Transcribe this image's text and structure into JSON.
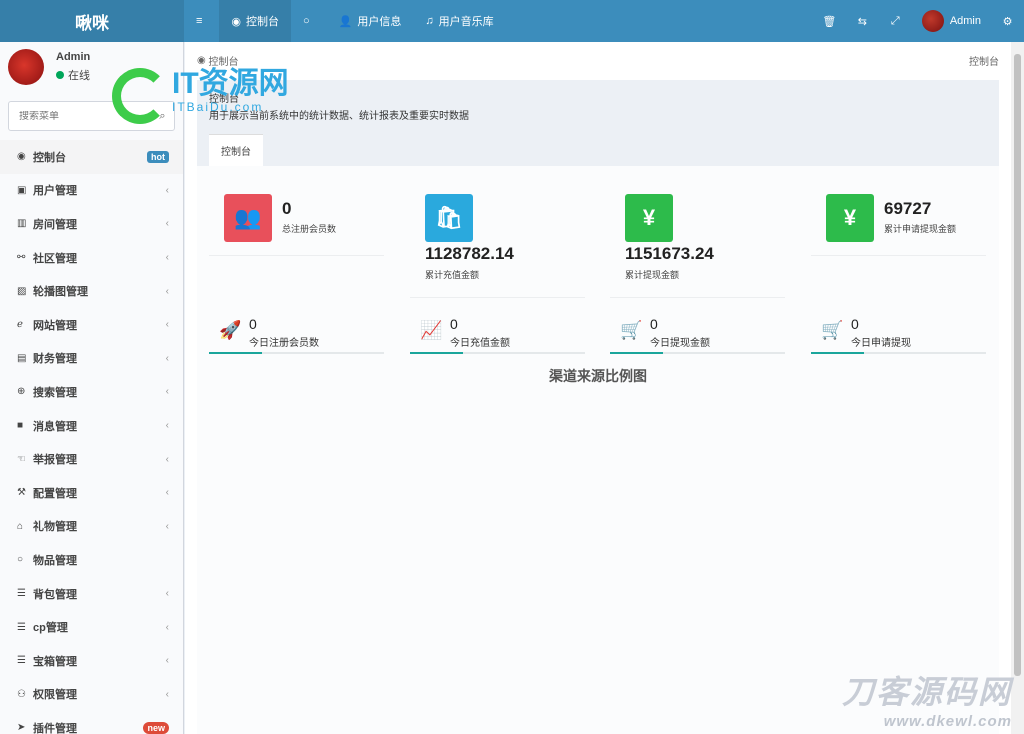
{
  "app": {
    "logo": "啾咪"
  },
  "topnav": [
    {
      "icon": "≡",
      "label": ""
    },
    {
      "icon": "◉",
      "label": "控制台"
    },
    {
      "icon": "○",
      "label": ""
    },
    {
      "icon": "👤",
      "label": "用户信息"
    },
    {
      "icon": "♫",
      "label": "用户音乐库"
    }
  ],
  "topright": {
    "icons": [
      "🗑",
      "⇆",
      "⤢"
    ],
    "user": "Admin",
    "settings_icon": "⚙"
  },
  "sidebar": {
    "user": {
      "name": "Admin",
      "status": "在线"
    },
    "search_placeholder": "搜索菜单",
    "items": [
      {
        "icon": "◉",
        "label": "控制台",
        "badge": "hot"
      },
      {
        "icon": "▣",
        "label": "用户管理",
        "arrow": "‹"
      },
      {
        "icon": "▥",
        "label": "房间管理",
        "arrow": "‹"
      },
      {
        "icon": "⚯",
        "label": "社区管理",
        "arrow": "‹"
      },
      {
        "icon": "▨",
        "label": "轮播图管理",
        "arrow": "‹"
      },
      {
        "icon": "ℯ",
        "label": "网站管理",
        "arrow": "‹"
      },
      {
        "icon": "▤",
        "label": "财务管理",
        "arrow": "‹"
      },
      {
        "icon": "⊕",
        "label": "搜索管理",
        "arrow": "‹"
      },
      {
        "icon": "■",
        "label": "消息管理",
        "arrow": "‹"
      },
      {
        "icon": "☜",
        "label": "举报管理",
        "arrow": "‹"
      },
      {
        "icon": "⚒",
        "label": "配置管理",
        "arrow": "‹"
      },
      {
        "icon": "⌂",
        "label": "礼物管理",
        "arrow": "‹"
      },
      {
        "icon": "○",
        "label": "物品管理",
        "arrow": ""
      },
      {
        "icon": "☰",
        "label": "背包管理",
        "arrow": "‹"
      },
      {
        "icon": "☰",
        "label": "cp管理",
        "arrow": "‹"
      },
      {
        "icon": "☰",
        "label": "宝箱管理",
        "arrow": "‹"
      },
      {
        "icon": "⚇",
        "label": "权限管理",
        "arrow": "‹"
      },
      {
        "icon": "➤",
        "label": "插件管理",
        "badge": "new"
      }
    ]
  },
  "breadcrumb": {
    "left": "控制台",
    "right": "控制台"
  },
  "pagehead": {
    "title": "控制台",
    "desc": "用于展示当前系统中的统计数据、统计报表及重要实时数据",
    "tab": "控制台"
  },
  "stats": [
    {
      "value": "0",
      "label": "总注册会员数",
      "color": "#e8505b",
      "icon": "👥"
    },
    {
      "value": "1128782.14",
      "label": "累计充值金额",
      "color": "#2aa9dd",
      "icon": "🛍"
    },
    {
      "value": "1151673.24",
      "label": "累计提现金额",
      "color": "#2dbb4b",
      "icon": "¥"
    },
    {
      "value": "69727",
      "label": "累计申请提现金额",
      "color": "#2dbb4b",
      "icon": "¥"
    }
  ],
  "mini_stats": [
    {
      "value": "0",
      "label": "今日注册会员数",
      "icon": "🚀"
    },
    {
      "value": "0",
      "label": "今日充值金额",
      "icon": "📈"
    },
    {
      "value": "0",
      "label": "今日提现金额",
      "icon": "🛒"
    },
    {
      "value": "0",
      "label": "今日申请提现",
      "icon": "🛒"
    }
  ],
  "chart_title": "渠道来源比例图",
  "watermarks": {
    "w1_big": "IT资源网",
    "w1_small": "ITBaiDu.com",
    "w2_big": "刀客源码网",
    "w2_small": "www.dkewl.com"
  }
}
